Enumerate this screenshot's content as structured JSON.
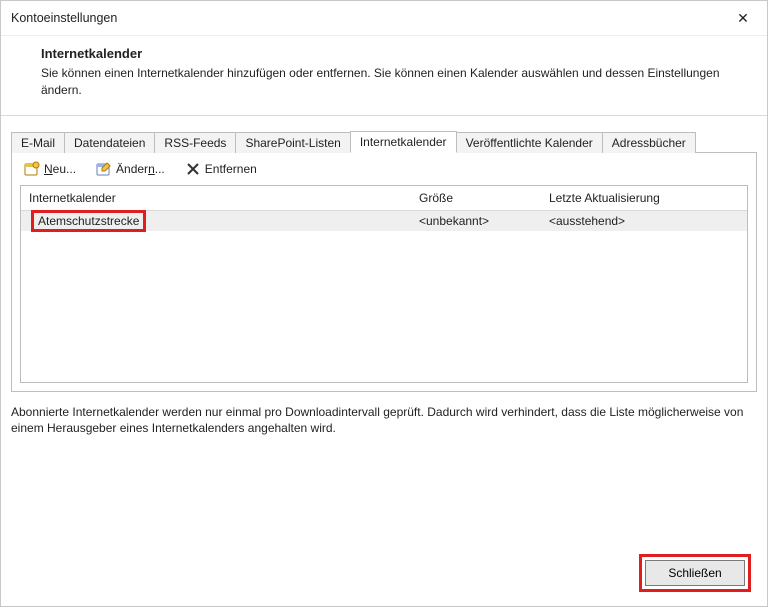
{
  "window": {
    "title": "Kontoeinstellungen"
  },
  "header": {
    "title": "Internetkalender",
    "subtitle": "Sie können einen Internetkalender hinzufügen oder entfernen. Sie können einen Kalender auswählen und dessen Einstellungen ändern."
  },
  "tabs": {
    "email": {
      "label": "E-Mail"
    },
    "datafiles": {
      "label": "Datendateien"
    },
    "rss": {
      "label": "RSS-Feeds"
    },
    "sharepoint": {
      "label": "SharePoint-Listen"
    },
    "internetcal": {
      "label": "Internetkalender"
    },
    "publishedcal": {
      "label": "Veröffentlichte Kalender"
    },
    "addressbooks": {
      "label": "Adressbücher"
    }
  },
  "toolbar": {
    "new": {
      "label": "Neu..."
    },
    "change": {
      "label": "Ändern..."
    },
    "remove": {
      "label": "Entfernen"
    }
  },
  "columns": {
    "name": "Internetkalender",
    "size": "Größe",
    "update": "Letzte Aktualisierung"
  },
  "rows": [
    {
      "name": "Atemschutzstrecke",
      "size": "<unbekannt>",
      "update": "<ausstehend>"
    }
  ],
  "info": "Abonnierte Internetkalender werden nur einmal pro Downloadintervall geprüft. Dadurch wird verhindert, dass die Liste möglicherweise von einem Herausgeber eines Internetkalenders angehalten wird.",
  "footer": {
    "close": "Schließen"
  },
  "icons": {
    "close_x": "✕"
  }
}
